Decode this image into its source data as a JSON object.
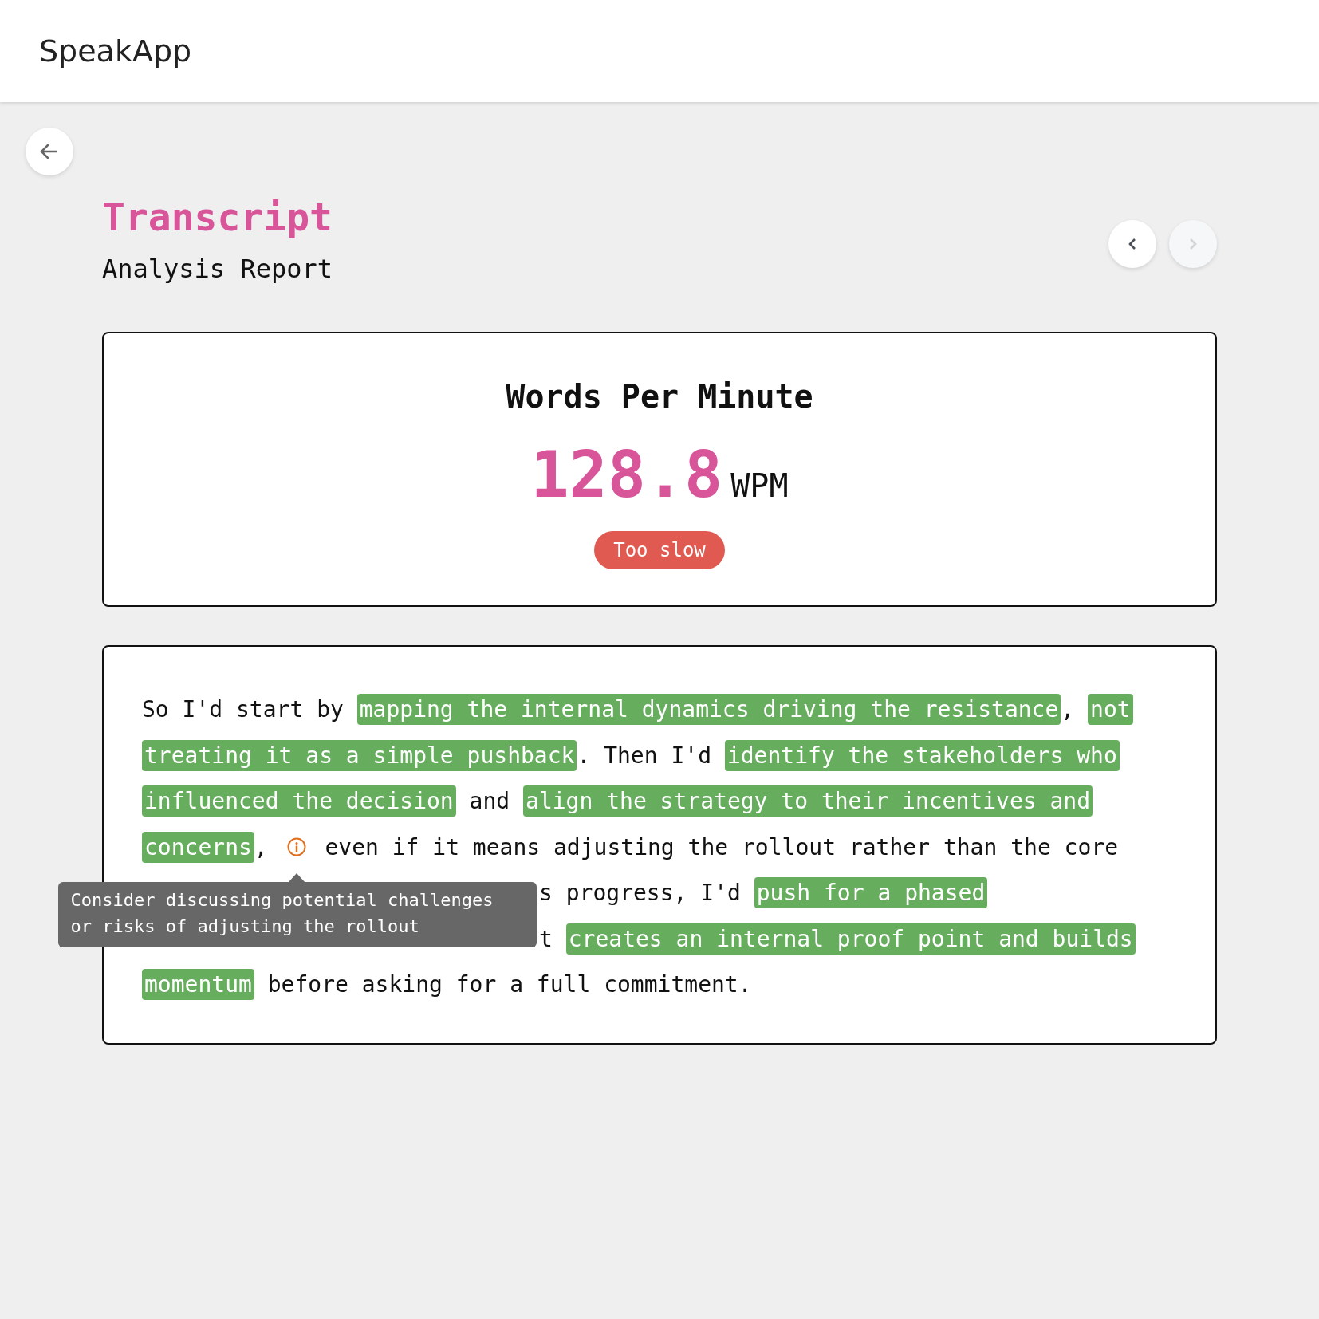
{
  "app": {
    "name": "SpeakApp"
  },
  "page": {
    "title": "Transcript",
    "subtitle": "Analysis Report"
  },
  "nav": {
    "previous": {
      "disabled": false
    },
    "next": {
      "disabled": true
    }
  },
  "wpm": {
    "title": "Words Per Minute",
    "value": "128.8",
    "unit": "WPM",
    "badge": "Too slow"
  },
  "transcript_lines": [
    {
      "covered": false,
      "segments": [
        {
          "kind": "text",
          "text": "So I'd start by "
        },
        {
          "kind": "highlight",
          "text": "mapping the internal dynamics driving the resistance"
        },
        {
          "kind": "text",
          "text": ", "
        },
        {
          "kind": "highlight",
          "text": "not"
        }
      ]
    },
    {
      "covered": false,
      "segments": [
        {
          "kind": "highlight",
          "text": "treating it as a simple pushback"
        },
        {
          "kind": "text",
          "text": ". Then I'd "
        },
        {
          "kind": "highlight",
          "text": "identify the stakeholders who"
        }
      ]
    },
    {
      "covered": false,
      "segments": [
        {
          "kind": "highlight",
          "text": "influenced the decision"
        },
        {
          "kind": "text",
          "text": " and "
        },
        {
          "kind": "highlight",
          "text": "align the strategy to their incentives and"
        }
      ]
    },
    {
      "covered": false,
      "segments": [
        {
          "kind": "highlight",
          "text": "concerns"
        },
        {
          "kind": "text",
          "text": ", "
        },
        {
          "kind": "note",
          "tooltip": "Consider discussing potential challenges or risks of adjusting the rollout"
        },
        {
          "kind": "text",
          "text": " even if it means adjusting the rollout rather than the core"
        }
      ]
    },
    {
      "covered": true,
      "segments": [
        {
          "kind": "text",
          "text": "s progress, I'd "
        },
        {
          "kind": "highlight",
          "text": "push for a phased"
        }
      ]
    },
    {
      "covered": true,
      "segments": [
        {
          "kind": "text",
          "text": "t "
        },
        {
          "kind": "highlight",
          "text": "creates an internal proof point and builds"
        }
      ]
    },
    {
      "covered": false,
      "segments": [
        {
          "kind": "highlight",
          "text": "momentum"
        },
        {
          "kind": "text",
          "text": " before asking for a full commitment."
        }
      ]
    }
  ]
}
